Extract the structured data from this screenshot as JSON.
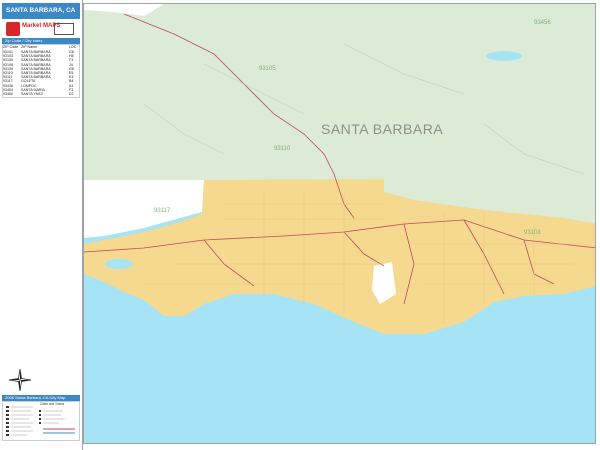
{
  "panel": {
    "title": "SANTA BARBARA, CA",
    "logo_word": "Market MAPS",
    "zip_header": "Zip Code / City Index",
    "zip_table": {
      "columns": [
        "ZIP Code",
        "ZIP Name",
        "LOC"
      ],
      "rows": [
        [
          "93101",
          "SANTA BARBARA",
          "G6"
        ],
        [
          "93103",
          "SANTA BARBARA",
          "H5"
        ],
        [
          "93105",
          "SANTA BARBARA",
          "F3"
        ],
        [
          "93108",
          "SANTA BARBARA",
          "J4"
        ],
        [
          "93109",
          "SANTA BARBARA",
          "G6"
        ],
        [
          "93110",
          "SANTA BARBARA",
          "E5"
        ],
        [
          "93111",
          "SANTA BARBARA",
          "E4"
        ],
        [
          "93117",
          "GOLETA",
          "B4"
        ],
        [
          "93436",
          "LOMPOC",
          "A1"
        ],
        [
          "93454",
          "SANTA MARIA",
          "F3"
        ],
        [
          "93460",
          "SANTA YNEZ",
          "D2"
        ]
      ]
    },
    "legend_header": "2008 Santa Barbara, CA City Map",
    "legend_sub": "Cities and Towns"
  },
  "map": {
    "region_label": "SANTA BARBARA",
    "zip_labels": [
      "93456",
      "93105",
      "93110",
      "93117",
      "93108"
    ],
    "colors": {
      "water": "#a6e3f5",
      "land": "#f5d98f",
      "forest": "#dcebd5",
      "road": "#c2495a",
      "accent": "#3b88c6"
    }
  }
}
